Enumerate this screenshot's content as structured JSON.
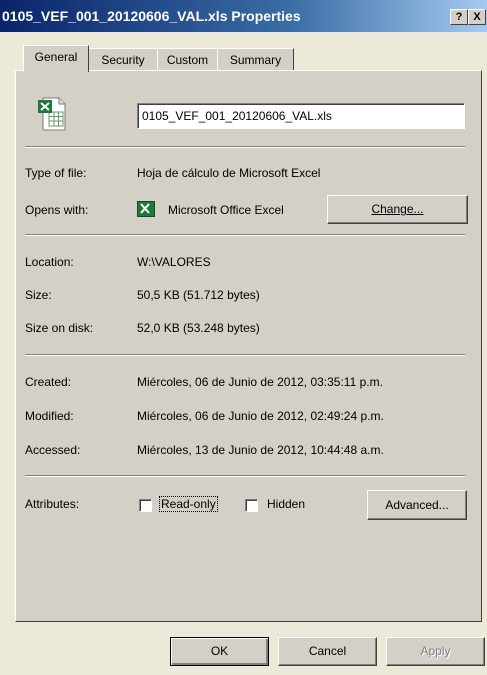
{
  "window": {
    "title": "0105_VEF_001_20120606_VAL.xls Properties",
    "help_label": "?",
    "close_label": "X"
  },
  "tabs": [
    {
      "label": "General"
    },
    {
      "label": "Security"
    },
    {
      "label": "Custom"
    },
    {
      "label": "Summary"
    }
  ],
  "file": {
    "name": "0105_VEF_001_20120606_VAL.xls",
    "icon": "excel-file-icon"
  },
  "fields": {
    "type_label": "Type of file:",
    "type_value": "Hoja de cálculo de Microsoft Excel",
    "opens_label": "Opens with:",
    "opens_value": "Microsoft Office Excel",
    "change_label": "Change...",
    "location_label": "Location:",
    "location_value": "W:\\VALORES",
    "size_label": "Size:",
    "size_value": "50,5 KB (51.712 bytes)",
    "disk_label": "Size on disk:",
    "disk_value": "52,0 KB (53.248 bytes)",
    "created_label": "Created:",
    "created_value": "Miércoles, 06 de Junio de 2012, 03:35:11 p.m.",
    "modified_label": "Modified:",
    "modified_value": "Miércoles, 06 de Junio de 2012, 02:49:24 p.m.",
    "accessed_label": "Accessed:",
    "accessed_value": "Miércoles, 13 de Junio de 2012, 10:44:48 a.m."
  },
  "attributes": {
    "label": "Attributes:",
    "readonly_label": "Read-only",
    "readonly_checked": false,
    "hidden_label": "Hidden",
    "hidden_checked": false,
    "advanced_label": "Advanced..."
  },
  "buttons": {
    "ok": "OK",
    "cancel": "Cancel",
    "apply": "Apply"
  }
}
